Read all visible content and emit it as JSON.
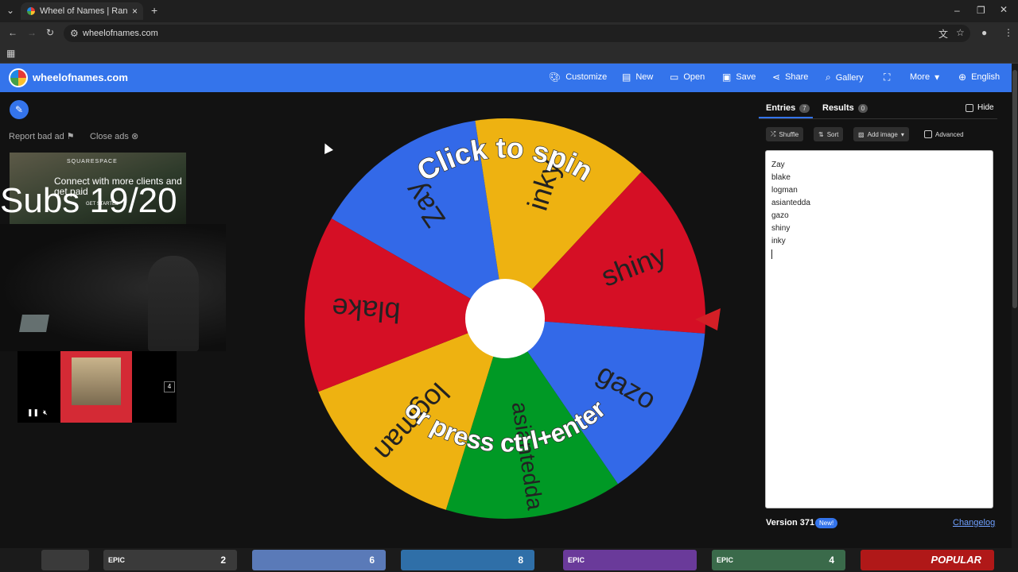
{
  "browser": {
    "tab_title": "Wheel of Names | Random nam",
    "tab_close": "×",
    "new_tab": "+",
    "url": "wheelofnames.com"
  },
  "app": {
    "brand": "wheelofnames.com",
    "nav": [
      {
        "label": "Customize",
        "icon": "palette-icon"
      },
      {
        "label": "New",
        "icon": "file-icon"
      },
      {
        "label": "Open",
        "icon": "folder-icon"
      },
      {
        "label": "Save",
        "icon": "floppy-icon"
      },
      {
        "label": "Share",
        "icon": "share-icon"
      },
      {
        "label": "Gallery",
        "icon": "search-icon"
      },
      {
        "label": "",
        "icon": "fullscreen-icon"
      },
      {
        "label": "More",
        "icon": "chevron-down-icon"
      },
      {
        "label": "English",
        "icon": "globe-icon"
      }
    ]
  },
  "left": {
    "report_label": "Report bad ad",
    "close_ads_label": "Close ads",
    "ad": {
      "brand": "SQUARESPACE",
      "headline": "Connect with more clients and get paid",
      "cta": "GET STARTED"
    },
    "overlay_text": "Subs 19/20",
    "video_ad_count": "4"
  },
  "wheel": {
    "center_text": "Click to spin",
    "bottom_text": "or press ctrl+enter",
    "segments": [
      {
        "name": "Zay",
        "color": "#3369e8"
      },
      {
        "name": "inky",
        "color": "#eeb211"
      },
      {
        "name": "shiny",
        "color": "#d50f25"
      },
      {
        "name": "gazo",
        "color": "#3369e8"
      },
      {
        "name": "asiantedda",
        "color": "#009925"
      },
      {
        "name": "logman",
        "color": "#eeb211"
      },
      {
        "name": "blake",
        "color": "#d50f25"
      }
    ]
  },
  "panel": {
    "tab_entries": "Entries",
    "entries_count": "7",
    "tab_results": "Results",
    "results_count": "0",
    "hide_label": "Hide",
    "shuffle_label": "Shuffle",
    "sort_label": "Sort",
    "add_image_label": "Add image",
    "advanced_label": "Advanced",
    "entries": [
      "Zay",
      "blake",
      "logman",
      "asiantedda",
      "gazo",
      "shiny",
      "inky"
    ],
    "version": "Version 371",
    "new_badge": "New!",
    "changelog": "Changelog"
  },
  "taskbar": {
    "tiles": [
      {
        "label": "EPIC",
        "count": "2",
        "color": "#3a3a3a"
      },
      {
        "label": "",
        "count": "6",
        "color": "#5a7ab8"
      },
      {
        "label": "",
        "count": "8",
        "color": "#2f6fa8"
      },
      {
        "label": "EPIC",
        "count": "",
        "color": "#6a3a9a"
      },
      {
        "label": "EPIC",
        "count": "4",
        "color": "#3a6a4a"
      },
      {
        "label": "POPULAR",
        "count": "",
        "color": "#b01818"
      }
    ]
  }
}
